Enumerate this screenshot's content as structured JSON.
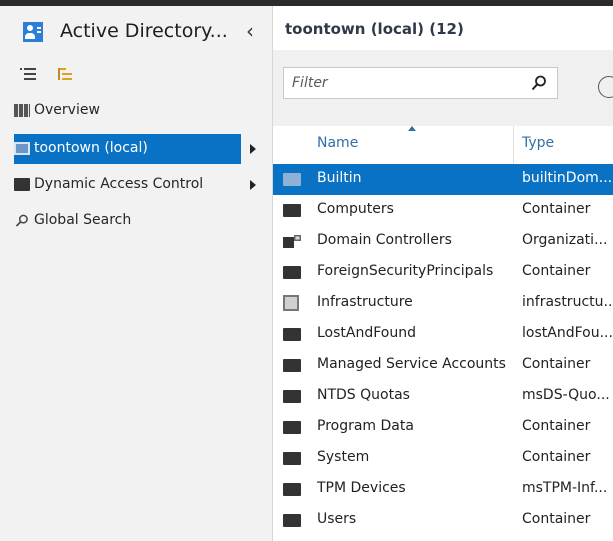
{
  "app": {
    "title": "Active Directory...",
    "icon": "directory-user-icon"
  },
  "nav": {
    "items": [
      {
        "label": "Overview",
        "icon": "grid-icon",
        "selected": false,
        "expandable": false
      },
      {
        "label": "toontown (local)",
        "icon": "domain-icon",
        "selected": true,
        "expandable": true
      },
      {
        "label": "Dynamic Access Control",
        "icon": "folder-icon",
        "selected": false,
        "expandable": true
      },
      {
        "label": "Global Search",
        "icon": "search-icon",
        "selected": false,
        "expandable": false
      }
    ]
  },
  "main": {
    "breadcrumb": "toontown (local)  (12)",
    "filter_placeholder": "Filter",
    "columns": {
      "name": "Name",
      "type": "Type"
    },
    "rows": [
      {
        "name": "Builtin",
        "type": "builtinDom...",
        "icon": "folder-icon",
        "selected": true
      },
      {
        "name": "Computers",
        "type": "Container",
        "icon": "folder-icon",
        "selected": false
      },
      {
        "name": "Domain Controllers",
        "type": "Organizati...",
        "icon": "org-unit-icon",
        "selected": false
      },
      {
        "name": "ForeignSecurityPrincipals",
        "type": "Container",
        "icon": "folder-icon",
        "selected": false
      },
      {
        "name": "Infrastructure",
        "type": "infrastructu...",
        "icon": "generic-object-icon",
        "selected": false
      },
      {
        "name": "LostAndFound",
        "type": "lostAndFou...",
        "icon": "folder-icon",
        "selected": false
      },
      {
        "name": "Managed Service Accounts",
        "type": "Container",
        "icon": "folder-icon",
        "selected": false
      },
      {
        "name": "NTDS Quotas",
        "type": "msDS-Quo...",
        "icon": "folder-icon",
        "selected": false
      },
      {
        "name": "Program Data",
        "type": "Container",
        "icon": "folder-icon",
        "selected": false
      },
      {
        "name": "System",
        "type": "Container",
        "icon": "folder-icon",
        "selected": false
      },
      {
        "name": "TPM Devices",
        "type": "msTPM-Inf...",
        "icon": "folder-icon",
        "selected": false
      },
      {
        "name": "Users",
        "type": "Container",
        "icon": "folder-icon",
        "selected": false
      }
    ]
  },
  "colors": {
    "accent": "#0a72c4",
    "nav_bg": "#f2f2f2",
    "header_text": "#2f6fa8"
  }
}
